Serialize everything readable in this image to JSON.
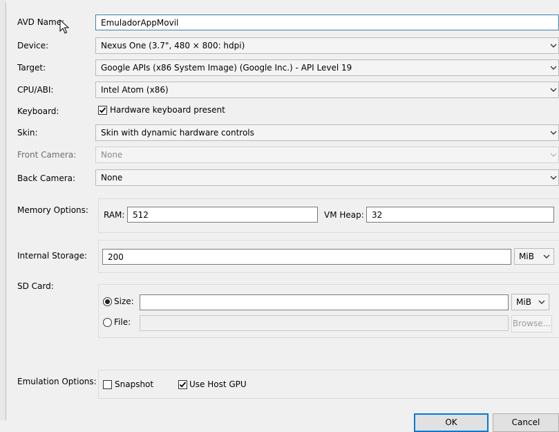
{
  "labels": {
    "avd_name": "AVD Name:",
    "device": "Device:",
    "target": "Target:",
    "cpu_abi": "CPU/ABI:",
    "keyboard": "Keyboard:",
    "skin": "Skin:",
    "front_camera": "Front Camera:",
    "back_camera": "Back Camera:",
    "memory_options": "Memory Options:",
    "internal_storage": "Internal Storage:",
    "sd_card": "SD Card:",
    "emulation_options": "Emulation Options:"
  },
  "fields": {
    "avd_name": "EmuladorAppMovil",
    "device": "Nexus One (3.7\", 480 × 800: hdpi)",
    "target": "Google APIs (x86 System Image) (Google Inc.) - API Level 19",
    "cpu_abi": "Intel Atom (x86)",
    "skin": "Skin with dynamic hardware controls",
    "front_camera": "None",
    "back_camera": "None"
  },
  "keyboard": {
    "label": "Hardware keyboard present",
    "checked": true
  },
  "memory": {
    "ram_label": "RAM:",
    "ram_value": "512",
    "vm_heap_label": "VM Heap:",
    "vm_heap_value": "32"
  },
  "internal_storage": {
    "value": "200",
    "unit": "MiB"
  },
  "sd_card": {
    "size_label": "Size:",
    "size_value": "",
    "size_unit": "MiB",
    "file_label": "File:",
    "file_value": "",
    "browse_label": "Browse..."
  },
  "emulation": {
    "snapshot_label": "Snapshot",
    "snapshot_checked": false,
    "host_gpu_label": "Use Host GPU",
    "host_gpu_checked": true
  },
  "buttons": {
    "ok": "OK",
    "cancel": "Cancel"
  },
  "icons": {
    "dropdown": "chevron-down-icon",
    "check": "checkmark-icon",
    "cursor": "mouse-pointer-icon"
  },
  "colors": {
    "focus_border": "#3c7fb1",
    "default_button_border": "#0078d7"
  }
}
